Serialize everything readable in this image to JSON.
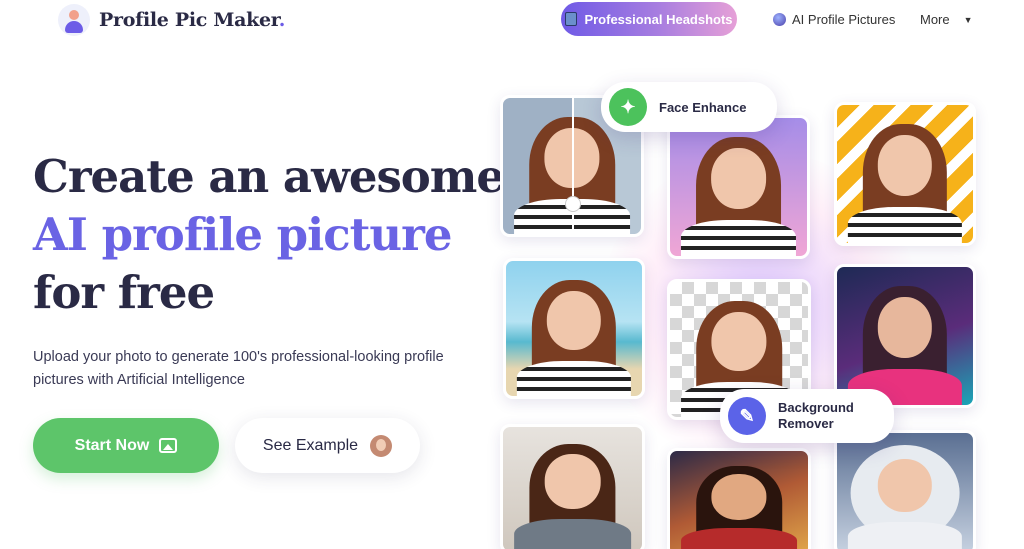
{
  "nav": {
    "brand": "Profile Pic Maker",
    "brand_dot": ".",
    "primary_link": "Professional Headshots",
    "links": [
      "AI Profile Pictures",
      "More"
    ]
  },
  "hero": {
    "line1": "Create an awesome",
    "line2": "AI profile picture",
    "line3": "for free",
    "subtitle": "Upload your photo to generate 100's professional-looking profile pictures with Artificial Intelligence",
    "cta_primary": "Start Now",
    "cta_secondary": "See Example"
  },
  "badges": {
    "face_enhance": "Face Enhance",
    "background_remover_1": "Background",
    "background_remover_2": "Remover"
  },
  "colors": {
    "accent": "#6a63e4",
    "cta_green": "#5dc56a",
    "heading": "#2a2a45"
  }
}
